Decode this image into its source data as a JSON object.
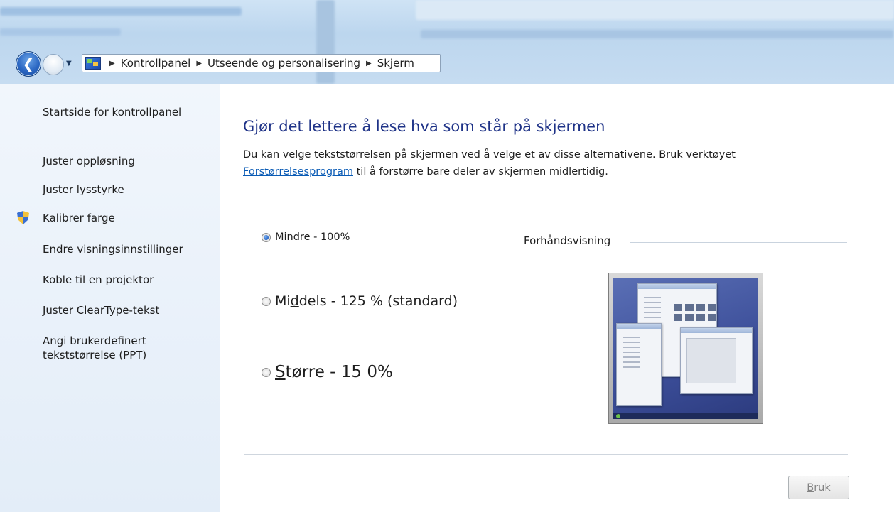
{
  "breadcrumb": {
    "items": [
      "Kontrollpanel",
      "Utseende og personalisering",
      "Skjerm"
    ]
  },
  "sidebar": {
    "home_link": "Startside for kontrollpanel",
    "items": [
      {
        "label": "Juster oppløsning"
      },
      {
        "label": "Juster lysstyrke"
      },
      {
        "label": "Kalibrer farge",
        "icon": "shield-icon"
      },
      {
        "label": "Endre visningsinnstillinger"
      },
      {
        "label": "Koble til en projektor"
      },
      {
        "label": "Juster ClearType-tekst"
      },
      {
        "label": "Angi brukerdefinert",
        "label_line2": "tekststørrelse (PPT)"
      }
    ]
  },
  "main": {
    "heading": "Gjør det lettere å lese hva som står på skjermen",
    "description_line1": "Du kan velge tekststørrelsen på skjermen ved å velge et av disse alternativene. Bruk verktøyet",
    "description_link": "Forstørrelsesprogram",
    "description_line2_rest": " til å forstørre bare deler av skjermen midlertidig.",
    "options": [
      {
        "before": "Mindre - 100%",
        "underlined": "",
        "after": "",
        "selected": true
      },
      {
        "before": "Mi",
        "underlined": "d",
        "after": "dels - 125 % (standard)",
        "selected": false
      },
      {
        "before": "",
        "underlined": "S",
        "after": "tørre - 15 0%",
        "selected": false
      }
    ],
    "preview_label": "Forhåndsvisning",
    "apply_button": {
      "underlined": "B",
      "rest": "ruk",
      "enabled": false
    }
  },
  "colors": {
    "heading": "#1e3287",
    "link": "#0a5bb5",
    "sidebar_bg": "#e3edf8",
    "disabled_text": "#838383"
  }
}
